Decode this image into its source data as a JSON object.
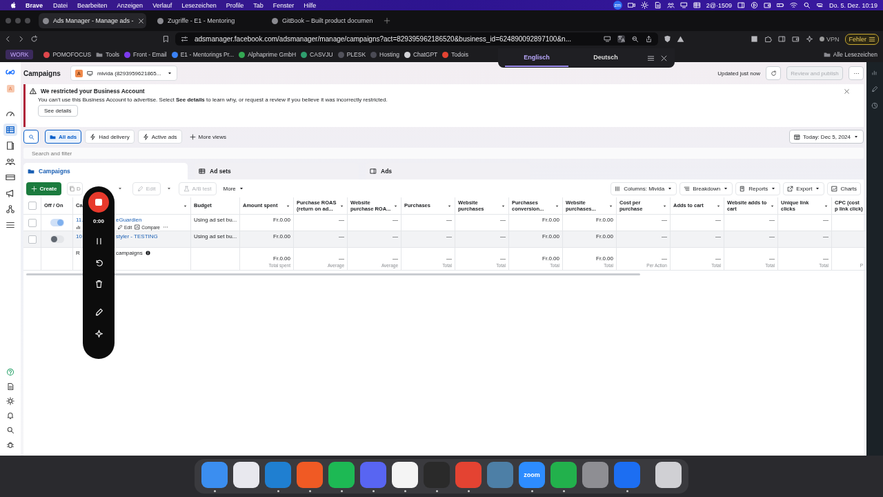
{
  "menubar": {
    "app": "Brave",
    "menus": [
      "Datei",
      "Bearbeiten",
      "Anzeigen",
      "Verlauf",
      "Lesezeichen",
      "Profile",
      "Tab",
      "Fenster",
      "Hilfe"
    ],
    "status_badge": "zm",
    "status_text": "2@·1509",
    "clock": "Do. 5. Dez. 10:19"
  },
  "browser": {
    "tabs": [
      {
        "title": "Ads Manager - Manage ads -",
        "selected": true
      },
      {
        "title": "Zugriffe - E1 - Mentoring",
        "selected": false
      },
      {
        "title": "GitBook – Built product documen",
        "selected": false
      }
    ],
    "url": "adsmanager.facebook.com/adsmanager/manage/campaigns?act=829395962186520&business_id=624890092897100&n...",
    "vpn": "VPN",
    "error_button": "Fehler",
    "bookmarks": [
      {
        "label": "WORK",
        "kind": "group"
      },
      {
        "label": "POMOFOCUS",
        "kind": "site",
        "color": "#e0474c"
      },
      {
        "label": "Tools",
        "kind": "folder"
      },
      {
        "label": "Front - Email",
        "kind": "site",
        "color": "#7c3aed"
      },
      {
        "label": "E1 - Mentorings Pr...",
        "kind": "site",
        "color": "#3b82f6"
      },
      {
        "label": "Alphaprime GmbH",
        "kind": "site",
        "color": "#34a853"
      },
      {
        "label": "CASVJU",
        "kind": "site",
        "color": "#2f9e6e"
      },
      {
        "label": "PLESK",
        "kind": "site",
        "color": "#52525b"
      },
      {
        "label": "Hosting",
        "kind": "site",
        "color": "#4b4b55"
      },
      {
        "label": "ChatGPT",
        "kind": "site",
        "color": "#d4d4d8"
      },
      {
        "label": "Todois",
        "kind": "site",
        "color": "#e44332"
      }
    ],
    "all_bookmarks": "Alle Lesezeichen",
    "translate": [
      {
        "label": "Englisch",
        "selected": true
      },
      {
        "label": "Deutsch",
        "selected": false
      }
    ]
  },
  "ads_manager": {
    "nav": [
      {
        "selected": false
      },
      {
        "selected": true
      },
      {
        "selected": false
      },
      {
        "selected": false
      },
      {
        "selected": false
      },
      {
        "selected": false
      },
      {
        "selected": false
      },
      {
        "selected": false
      }
    ],
    "avatar": "A",
    "title": "Campaigns",
    "account": {
      "badge": "A",
      "name": "mivida (8293959621865..."
    },
    "updated": "Updated just now",
    "publish": {
      "label": "Review and publish",
      "disabled": true
    },
    "alert": {
      "title": "We restricted your Business Account",
      "text": "You can't use this Business Account to advertise. Select **See details** to learn why, or request a review if you believe it was incorrectly restricted.",
      "button": "See details"
    },
    "views": [
      {
        "label": "All ads",
        "kind": "folder",
        "selected": true
      },
      {
        "label": "Had delivery",
        "kind": "bolt",
        "selected": false
      },
      {
        "label": "Active ads",
        "kind": "bolt",
        "selected": false
      }
    ],
    "more_views": "More views",
    "date": "Today: Dec 5, 2024",
    "search": {
      "placeholder": "Search and filter"
    },
    "levels": [
      {
        "label": "Campaigns",
        "selected": true
      },
      {
        "label": "Ad sets",
        "selected": false
      },
      {
        "label": "Ads",
        "selected": false
      }
    ],
    "toolbar": {
      "create": "Create",
      "duplicate": "D",
      "edit": {
        "label": "Edit",
        "disabled": true
      },
      "ab_test": {
        "label": "A/B test",
        "disabled": true
      },
      "more": "More",
      "right": [
        {
          "label": "Columns: Mivida",
          "kind": "columns"
        },
        {
          "label": "Breakdown",
          "kind": "breakdown"
        },
        {
          "label": "Reports",
          "kind": "reports"
        },
        {
          "label": "Export",
          "kind": "export"
        },
        {
          "label": "Charts",
          "kind": "charts"
        }
      ]
    },
    "table": {
      "all_selected": false,
      "columns": [
        {
          "label": "Off / On",
          "menu": false
        },
        {
          "label": "Ca",
          "menu": true
        },
        {
          "label": "Budget",
          "menu": false
        },
        {
          "label": "Amount spent",
          "menu": true
        },
        {
          "label": "Purchase ROAS (return on ad...",
          "menu": true
        },
        {
          "label": "Website purchase ROA...",
          "menu": true
        },
        {
          "label": "Purchases",
          "menu": true
        },
        {
          "label": "Website purchases",
          "menu": true
        },
        {
          "label": "Purchases conversion...",
          "menu": true
        },
        {
          "label": "Website purchases...",
          "menu": true
        },
        {
          "label": "Cost per purchase",
          "menu": true
        },
        {
          "label": "Adds to cart",
          "menu": true
        },
        {
          "label": "Website adds to cart",
          "menu": true
        },
        {
          "label": "Unique link clicks",
          "menu": true
        },
        {
          "label": "CPC (cost p link click)",
          "menu": false
        }
      ],
      "rows": [
        {
          "selected": false,
          "on": true,
          "highlighted": false,
          "name_start": "11.",
          "name_end": "eGuardien",
          "actions": [
            "Edit",
            "Compare"
          ],
          "budget": "Using ad set bu...",
          "values": [
            "Fr.0.00",
            "—",
            "—",
            "—",
            "—",
            "Fr.0.00",
            "Fr.0.00",
            "—",
            "—",
            "—",
            "—"
          ]
        },
        {
          "selected": false,
          "on": false,
          "highlighted": true,
          "name_start": "10",
          "name_end": "styler - TESTING",
          "budget": "Using ad set bu...",
          "values": [
            "Fr.0.00",
            "—",
            "—",
            "—",
            "—",
            "Fr.0.00",
            "Fr.0.00",
            "—",
            "—",
            "—",
            "—"
          ]
        }
      ],
      "totals": {
        "label_start": "R",
        "label_end": "campaigns",
        "values": [
          {
            "value": "Fr.0.00",
            "note": "Total spent"
          },
          {
            "value": "—",
            "note": "Average"
          },
          {
            "value": "—",
            "note": "Average"
          },
          {
            "value": "—",
            "note": "Total"
          },
          {
            "value": "—",
            "note": "Total"
          },
          {
            "value": "Fr.0.00",
            "note": "Total"
          },
          {
            "value": "Fr.0.00",
            "note": "Total"
          },
          {
            "value": "—",
            "note": "Per Action"
          },
          {
            "value": "—",
            "note": "Total"
          },
          {
            "value": "—",
            "note": "Total"
          },
          {
            "value": "—",
            "note": "Total"
          },
          {
            "note": "P"
          }
        ]
      }
    }
  },
  "recorder": {
    "time": "0:00"
  },
  "dock": [
    {
      "color": "#3b8ef0",
      "running": true
    },
    {
      "color": "#e8e8ee",
      "running": false
    },
    {
      "color": "#1f7fd1",
      "running": true
    },
    {
      "color": "#f05a24",
      "running": true
    },
    {
      "color": "#1db954",
      "running": true
    },
    {
      "color": "#5865f2",
      "running": true
    },
    {
      "color": "#f4f4f4",
      "running": true
    },
    {
      "color": "#2a2a2a",
      "running": true
    },
    {
      "color": "#e44332",
      "running": true
    },
    {
      "color": "#4d7fa6",
      "running": false
    },
    {
      "color": "#2d8cff",
      "running": true,
      "label": "zoom"
    },
    {
      "color": "#22b14c",
      "running": true
    },
    {
      "color": "#8e8e93",
      "running": false
    },
    {
      "color": "#1c6ef2",
      "running": true
    },
    {
      "color": "#d0d0d4",
      "running": false
    }
  ]
}
